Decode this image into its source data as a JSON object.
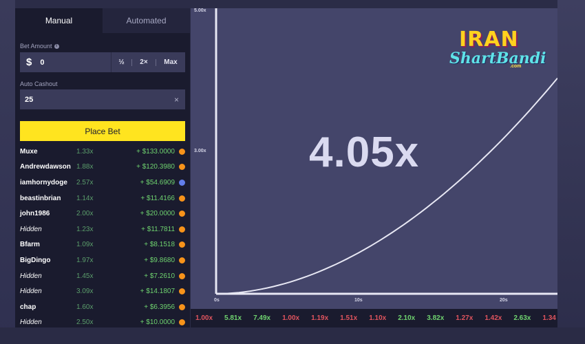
{
  "tabs": [
    {
      "label": "Manual",
      "active": true
    },
    {
      "label": "Automated",
      "active": false
    }
  ],
  "bet_amount": {
    "label": "Bet Amount",
    "currency_symbol": "$",
    "value": "0",
    "half_label": "½",
    "double_label": "2×",
    "max_label": "Max"
  },
  "auto_cashout": {
    "label": "Auto Cashout",
    "value": "25",
    "clear_label": "×"
  },
  "place_bet_label": "Place Bet",
  "bets": [
    {
      "name": "Muxe",
      "mult": "1.33x",
      "profit": "+ $133.0000",
      "coin": "btc",
      "hidden": false
    },
    {
      "name": "Andrewdawson",
      "mult": "1.88x",
      "profit": "+ $120.3980",
      "coin": "btc",
      "hidden": false
    },
    {
      "name": "iamhornydoge",
      "mult": "2.57x",
      "profit": "+ $54.6909",
      "coin": "eth",
      "hidden": false
    },
    {
      "name": "beastinbrian",
      "mult": "1.14x",
      "profit": "+ $11.4166",
      "coin": "btc",
      "hidden": false
    },
    {
      "name": "john1986",
      "mult": "2.00x",
      "profit": "+ $20.0000",
      "coin": "btc",
      "hidden": false
    },
    {
      "name": "Hidden",
      "mult": "1.23x",
      "profit": "+ $11.7811",
      "coin": "btc",
      "hidden": true
    },
    {
      "name": "Bfarm",
      "mult": "1.09x",
      "profit": "+ $8.1518",
      "coin": "btc",
      "hidden": false
    },
    {
      "name": "BigDingo",
      "mult": "1.97x",
      "profit": "+ $9.8680",
      "coin": "btc",
      "hidden": false
    },
    {
      "name": "Hidden",
      "mult": "1.45x",
      "profit": "+ $7.2610",
      "coin": "btc",
      "hidden": true
    },
    {
      "name": "Hidden",
      "mult": "3.09x",
      "profit": "+ $14.1807",
      "coin": "btc",
      "hidden": true
    },
    {
      "name": "chap",
      "mult": "1.60x",
      "profit": "+ $6.3956",
      "coin": "btc",
      "hidden": false
    },
    {
      "name": "Hidden",
      "mult": "2.50x",
      "profit": "+ $10.0000",
      "coin": "btc",
      "hidden": true
    }
  ],
  "graph": {
    "current_multiplier": "4.05x",
    "y_labels": [
      "5.00x",
      "3.00x"
    ],
    "x_labels": [
      "0s",
      "10s",
      "20s"
    ],
    "y_range": [
      1,
      5
    ],
    "x_range": [
      0,
      23
    ],
    "curve_color": "#e8e8f4",
    "axis_color": "#e8e8f4"
  },
  "logo": {
    "top": "IRAN",
    "bottom": "ShartBandi",
    "suffix": ".com"
  },
  "history": [
    {
      "value": "1.00x",
      "color": "red"
    },
    {
      "value": "5.81x",
      "color": "green"
    },
    {
      "value": "7.49x",
      "color": "green"
    },
    {
      "value": "1.00x",
      "color": "red"
    },
    {
      "value": "1.19x",
      "color": "red"
    },
    {
      "value": "1.51x",
      "color": "red"
    },
    {
      "value": "1.10x",
      "color": "red"
    },
    {
      "value": "2.10x",
      "color": "green"
    },
    {
      "value": "3.82x",
      "color": "green"
    },
    {
      "value": "1.27x",
      "color": "red"
    },
    {
      "value": "1.42x",
      "color": "red"
    },
    {
      "value": "2.63x",
      "color": "green"
    },
    {
      "value": "1.34",
      "color": "red"
    }
  ]
}
